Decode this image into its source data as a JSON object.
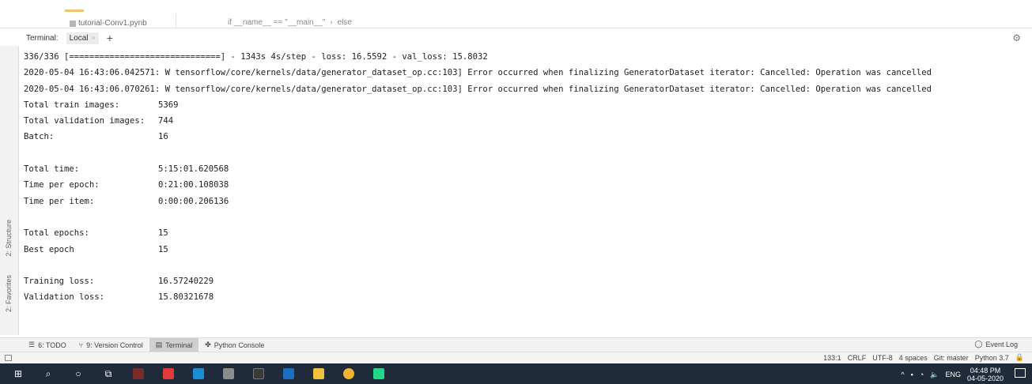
{
  "editor": {
    "project_file": "tutorial-Conv1.pynb",
    "breadcrumb": [
      "if __name__ == \"__main__\"",
      "›",
      "else"
    ]
  },
  "terminal_panel": {
    "title": "Terminal:",
    "tab_local": "Local",
    "tab_close": "×",
    "tab_add": "+",
    "settings_icon": "gear-icon"
  },
  "left_stripe": {
    "structure": "2: Structure",
    "favorites": "2: Favorites"
  },
  "output": {
    "progress_line": "336/336 [==============================] - 1343s 4s/step - loss: 16.5592 - val_loss: 15.8032",
    "warn_lines": [
      "2020-05-04 16:43:06.042571: W tensorflow/core/kernels/data/generator_dataset_op.cc:103] Error occurred when finalizing GeneratorDataset iterator: Cancelled: Operation was cancelled",
      "2020-05-04 16:43:06.070261: W tensorflow/core/kernels/data/generator_dataset_op.cc:103] Error occurred when finalizing GeneratorDataset iterator: Cancelled: Operation was cancelled"
    ],
    "stats_a": [
      {
        "key": "Total train images:",
        "value": "5369"
      },
      {
        "key": "Total validation images:",
        "value": "744"
      },
      {
        "key": "Batch:",
        "value": "16"
      }
    ],
    "stats_b": [
      {
        "key": "Total time:",
        "value": "5:15:01.620568"
      },
      {
        "key": "Time per epoch:",
        "value": "0:21:00.108038"
      },
      {
        "key": "Time per item:",
        "value": "0:00:00.206136"
      }
    ],
    "stats_c": [
      {
        "key": "Total epochs:",
        "value": "15"
      },
      {
        "key": "Best epoch",
        "value": "15"
      }
    ],
    "stats_d": [
      {
        "key": "Training loss:",
        "value": "16.57240229"
      },
      {
        "key": "Validation loss:",
        "value": "15.80321678"
      }
    ]
  },
  "tool_tabs": {
    "todo": "6: TODO",
    "vcs": "9: Version Control",
    "terminal": "Terminal",
    "python_console": "Python Console",
    "event_log": "Event Log"
  },
  "status_bar": {
    "position": "133:1",
    "line_sep": "CRLF",
    "encoding": "UTF-8",
    "indent": "4 spaces",
    "git": "Git: master",
    "interpreter": "Python 3.7"
  },
  "taskbar": {
    "lang": "ENG",
    "time": "04:48 PM",
    "date": "04-05-2020",
    "colors": {
      "bg": "#1f2b3a",
      "pycharm": "#21d789",
      "red_app": "#e23b3b",
      "blue_app": "#1a8fd6",
      "chrome": "#f2b233"
    }
  }
}
